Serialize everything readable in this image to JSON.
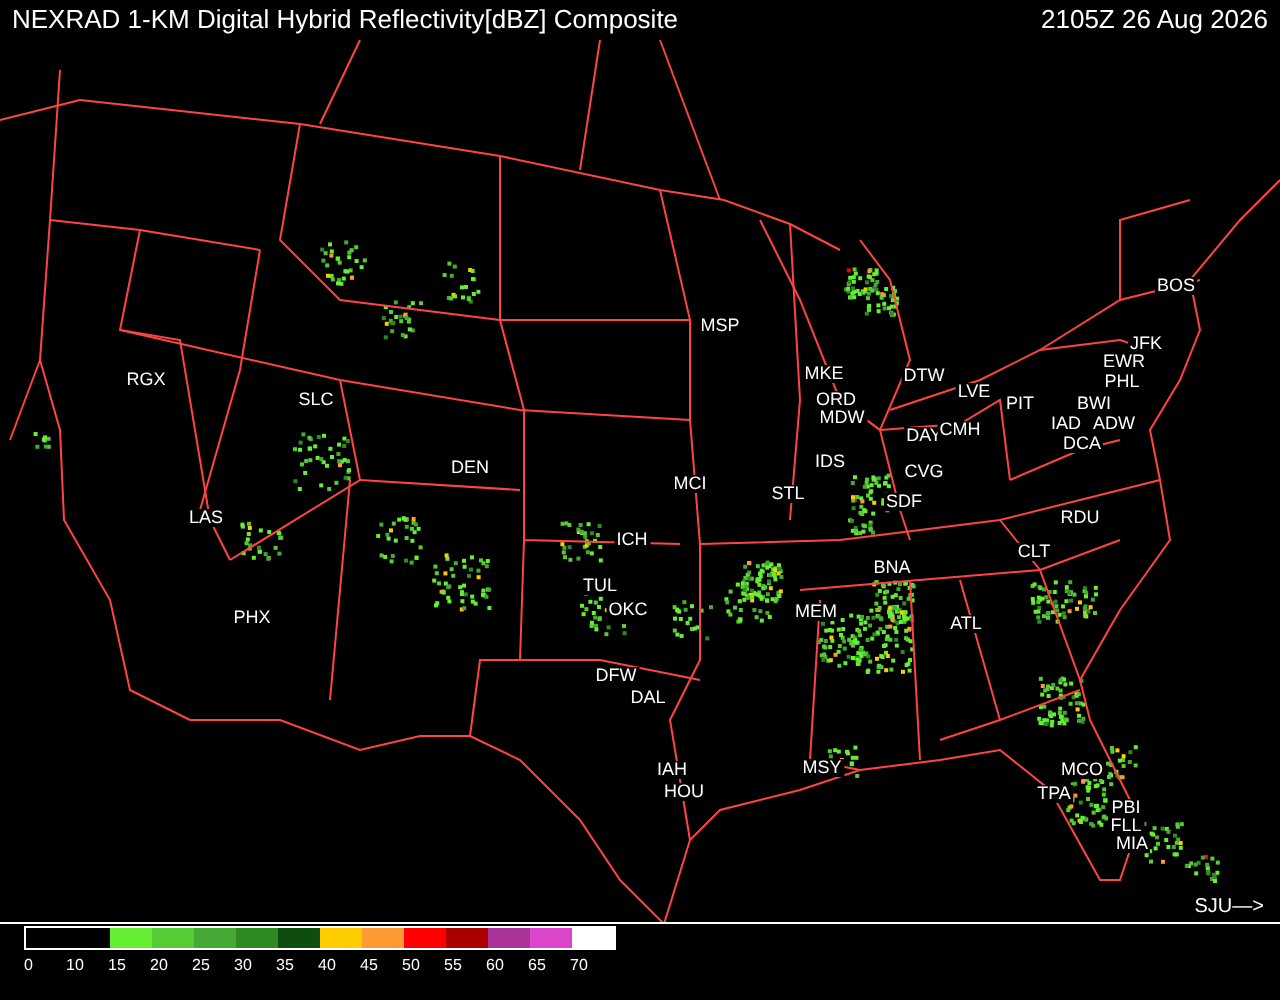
{
  "header": {
    "title": "NEXRAD 1-KM Digital Hybrid Reflectivity[dBZ] Composite",
    "time": "2105Z 26 Aug 2026"
  },
  "map": {
    "cities": [
      {
        "code": "RGX"
      },
      {
        "code": "SLC"
      },
      {
        "code": "DEN"
      },
      {
        "code": "LAS"
      },
      {
        "code": "PHX"
      },
      {
        "code": "MSP"
      },
      {
        "code": "MKE"
      },
      {
        "code": "ORD"
      },
      {
        "code": "MDW"
      },
      {
        "code": "DTW"
      },
      {
        "code": "LVE"
      },
      {
        "code": "PIT"
      },
      {
        "code": "BOS"
      },
      {
        "code": "JFK"
      },
      {
        "code": "EWR"
      },
      {
        "code": "PHL"
      },
      {
        "code": "DAY"
      },
      {
        "code": "CMH"
      },
      {
        "code": "BWI"
      },
      {
        "code": "IAD"
      },
      {
        "code": "ADW"
      },
      {
        "code": "DCA"
      },
      {
        "code": "IDS"
      },
      {
        "code": "CVG"
      },
      {
        "code": "SDF"
      },
      {
        "code": "STL"
      },
      {
        "code": "MCI"
      },
      {
        "code": "ICH"
      },
      {
        "code": "TUL"
      },
      {
        "code": "OKC"
      },
      {
        "code": "DFW"
      },
      {
        "code": "DAL"
      },
      {
        "code": "IAH"
      },
      {
        "code": "HOU"
      },
      {
        "code": "MEM"
      },
      {
        "code": "BNA"
      },
      {
        "code": "ATL"
      },
      {
        "code": "CLT"
      },
      {
        "code": "RDU"
      },
      {
        "code": "MSY"
      },
      {
        "code": "MCO"
      },
      {
        "code": "TPA"
      },
      {
        "code": "PBI"
      },
      {
        "code": "FLL"
      },
      {
        "code": "MIA"
      }
    ],
    "offscreen_pointer": "SJU—>"
  },
  "legend": {
    "swatches": [
      {
        "color": "#66ee33"
      },
      {
        "color": "#55cc33"
      },
      {
        "color": "#44aa33"
      },
      {
        "color": "#2e8a22"
      },
      {
        "color": "#0e4d0e"
      },
      {
        "color": "#ffcc00"
      },
      {
        "color": "#ff9933"
      },
      {
        "color": "#ff0000"
      },
      {
        "color": "#aa0000"
      },
      {
        "color": "#aa3399"
      },
      {
        "color": "#dd44cc"
      },
      {
        "color": "#ffffff"
      }
    ],
    "ticks": [
      "0",
      "10",
      "15",
      "20",
      "25",
      "30",
      "35",
      "40",
      "45",
      "50",
      "55",
      "60",
      "65",
      "70"
    ]
  }
}
